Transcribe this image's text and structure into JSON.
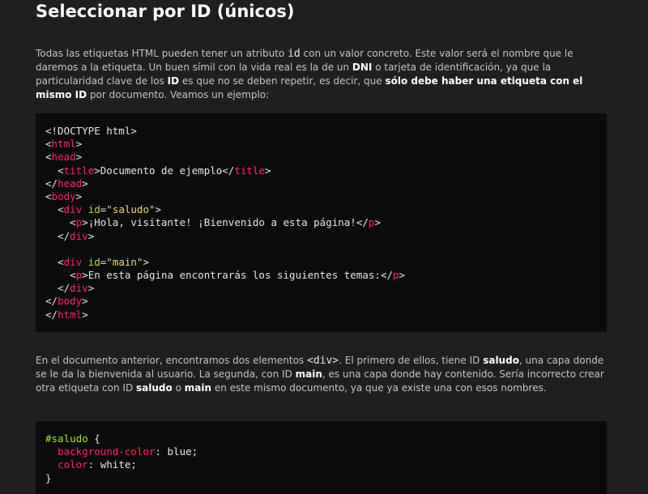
{
  "section_title": "Seleccionar por ID (únicos)",
  "intro": {
    "t1": "Todas las etiquetas HTML pueden tener un atributo ",
    "code_id": "id",
    "t2": " con un valor concreto. Este valor será el nombre que le daremos a la etiqueta. Un buen símil con la vida real es la de un ",
    "b_dni": "DNI",
    "t3": " o tarjeta de identificación, ya que la particularidad clave de los ",
    "b_id": "ID",
    "t4": " es que no se deben repetir, es decir, que ",
    "b_only": "sólo debe haber una etiqueta con el mismo ID",
    "t5": " por documento. Veamos un ejemplo:"
  },
  "code_html": {
    "doctype": "<!DOCTYPE html>",
    "lt": "<",
    "lts": "</",
    "gt": ">",
    "tag_html": "html",
    "tag_head": "head",
    "tag_title": "title",
    "title_text": "Documento de ejemplo",
    "tag_body": "body",
    "tag_div": "div",
    "attr_id": "id",
    "eq": "=",
    "val_saludo": "\"saludo\"",
    "val_main": "\"main\"",
    "tag_p": "p",
    "p1_text": "¡Hola, visitante! ¡Bienvenido a esta página!",
    "p2_text": "En esta página encontrarás los siguientes temas:"
  },
  "explanation": {
    "t1": "En el documento anterior, encontramos dos elementos ",
    "code_div": "<div>",
    "t2": ". El primero de ellos, tiene ID ",
    "b_saludo": "saludo",
    "t3": ", una capa donde se le da la bienvenida al usuario. La segunda, con ID ",
    "b_main": "main",
    "t4": ", es una capa donde hay contenido. Sería incorrecto crear otra etiqueta con ID ",
    "b_saludo2": "saludo",
    "t5": " o ",
    "b_main2": "main",
    "t6": " en este mismo documento, ya que ya existe una con esos nombres."
  },
  "code_css": {
    "selector": "#saludo",
    "open": " {",
    "prop1": "background-color",
    "val1": ": blue;",
    "prop2": "color",
    "val2": ": white;",
    "close": "}"
  },
  "colors": {
    "background": "#1f1f1f",
    "code_background": "#0b0b0b",
    "tag": "#f92672",
    "attribute": "#a6e22e",
    "string": "#e6db74"
  }
}
